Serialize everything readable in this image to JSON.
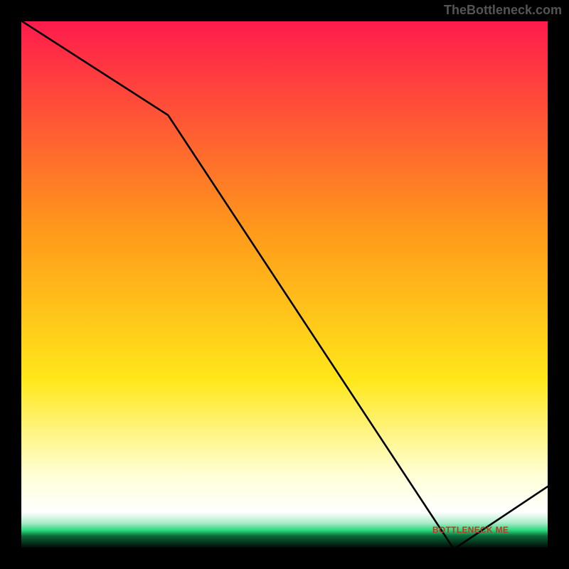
{
  "attribution": "TheBottleneck.com",
  "watermark": "BOTTLENECK ME",
  "chart_data": {
    "type": "line",
    "x": [
      0,
      0.28,
      0.82,
      1.0
    ],
    "values": [
      1.0,
      0.82,
      0.0,
      0.12
    ],
    "title": "",
    "xlabel": "",
    "ylabel": "",
    "xlim": [
      0,
      1
    ],
    "ylim": [
      0,
      1
    ],
    "background_gradient": {
      "top": "#ff1a4d",
      "upper_mid": "#ff9a1a",
      "mid": "#ffe71a",
      "lower_mid_pale": "#ffffd6",
      "green_band": "#27d67a",
      "bottom": "#000000"
    },
    "watermark_y_fraction": 0.035,
    "watermark_x_fraction": 0.84
  },
  "colors": {
    "line": "#000000",
    "frame_border": "#000000",
    "attribution_text": "#555555",
    "watermark_text": "#c23322"
  }
}
